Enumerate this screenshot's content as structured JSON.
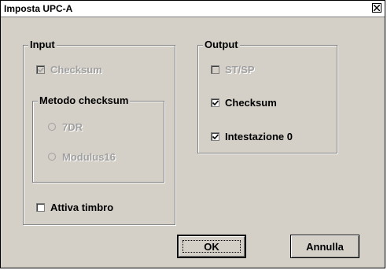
{
  "window": {
    "title": "Imposta UPC-A"
  },
  "input_group": {
    "legend": "Input",
    "checksum": {
      "label": "Checksum",
      "checked": true,
      "enabled": false
    },
    "method_group": {
      "legend": "Metodo checksum",
      "options": [
        {
          "label": "7DR",
          "selected": false,
          "enabled": false
        },
        {
          "label": "Modulus16",
          "selected": false,
          "enabled": false
        }
      ]
    },
    "stamp": {
      "label": "Attiva timbro",
      "checked": false,
      "enabled": true
    }
  },
  "output_group": {
    "legend": "Output",
    "stsp": {
      "label": "ST/SP",
      "checked": false,
      "enabled": false
    },
    "checksum": {
      "label": "Checksum",
      "checked": true,
      "enabled": true
    },
    "header0": {
      "label": "Intestazione 0",
      "checked": true,
      "enabled": true
    }
  },
  "buttons": {
    "ok": "OK",
    "cancel": "Annulla"
  }
}
